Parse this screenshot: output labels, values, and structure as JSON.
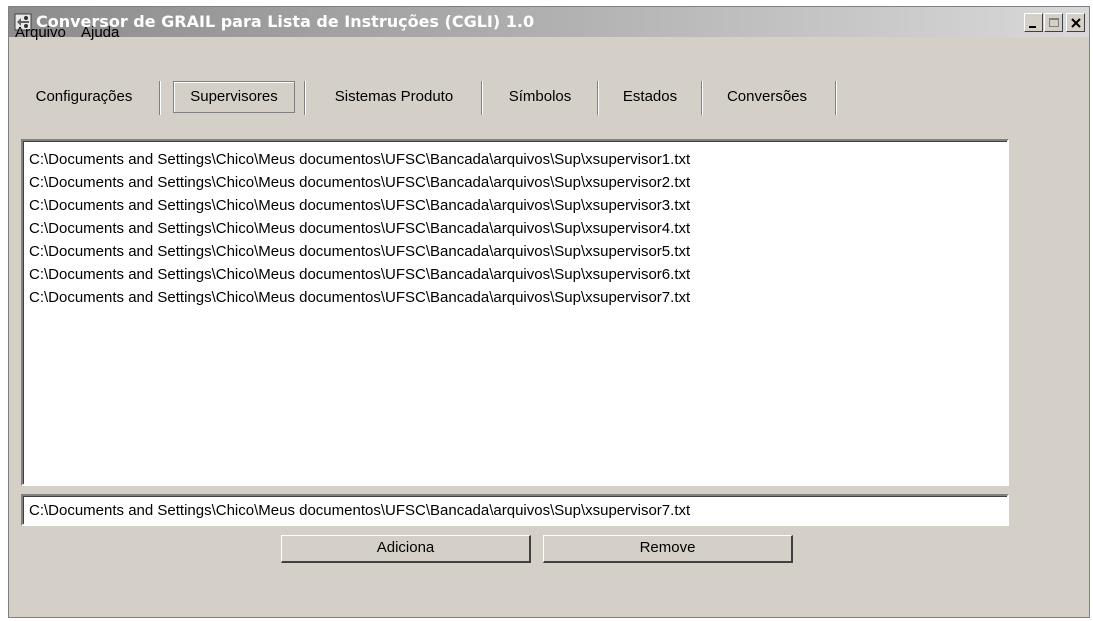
{
  "window": {
    "title": "Conversor de GRAIL para Lista de Instruções (CGLI) 1.0",
    "controls": [
      "minimize",
      "maximize",
      "close"
    ]
  },
  "menu": [
    {
      "label": "Arquivo"
    },
    {
      "label": "Ajuda"
    }
  ],
  "tabs": [
    {
      "label": "Configurações",
      "active": false
    },
    {
      "label": "Supervisores",
      "active": true
    },
    {
      "label": "Sistemas Produto",
      "active": false
    },
    {
      "label": "Símbolos",
      "active": false
    },
    {
      "label": "Estados",
      "active": false
    },
    {
      "label": "Conversões",
      "active": false
    }
  ],
  "supervisor_list": [
    "C:\\Documents and Settings\\Chico\\Meus documentos\\UFSC\\Bancada\\arquivos\\Sup\\xsupervisor1.txt",
    "C:\\Documents and Settings\\Chico\\Meus documentos\\UFSC\\Bancada\\arquivos\\Sup\\xsupervisor2.txt",
    "C:\\Documents and Settings\\Chico\\Meus documentos\\UFSC\\Bancada\\arquivos\\Sup\\xsupervisor3.txt",
    "C:\\Documents and Settings\\Chico\\Meus documentos\\UFSC\\Bancada\\arquivos\\Sup\\xsupervisor4.txt",
    "C:\\Documents and Settings\\Chico\\Meus documentos\\UFSC\\Bancada\\arquivos\\Sup\\xsupervisor5.txt",
    "C:\\Documents and Settings\\Chico\\Meus documentos\\UFSC\\Bancada\\arquivos\\Sup\\xsupervisor6.txt",
    "C:\\Documents and Settings\\Chico\\Meus documentos\\UFSC\\Bancada\\arquivos\\Sup\\xsupervisor7.txt"
  ],
  "path_input": {
    "value": "C:\\Documents and Settings\\Chico\\Meus documentos\\UFSC\\Bancada\\arquivos\\Sup\\xsupervisor7.txt"
  },
  "buttons": {
    "add_label": "Adiciona",
    "remove_label": "Remove"
  },
  "icons": {
    "app": "app-icon",
    "minimize": "minimize-icon",
    "maximize": "maximize-icon",
    "close": "close-icon"
  },
  "colors": {
    "window_bg": "#d4d0c8",
    "title_text": "#ffffff"
  }
}
